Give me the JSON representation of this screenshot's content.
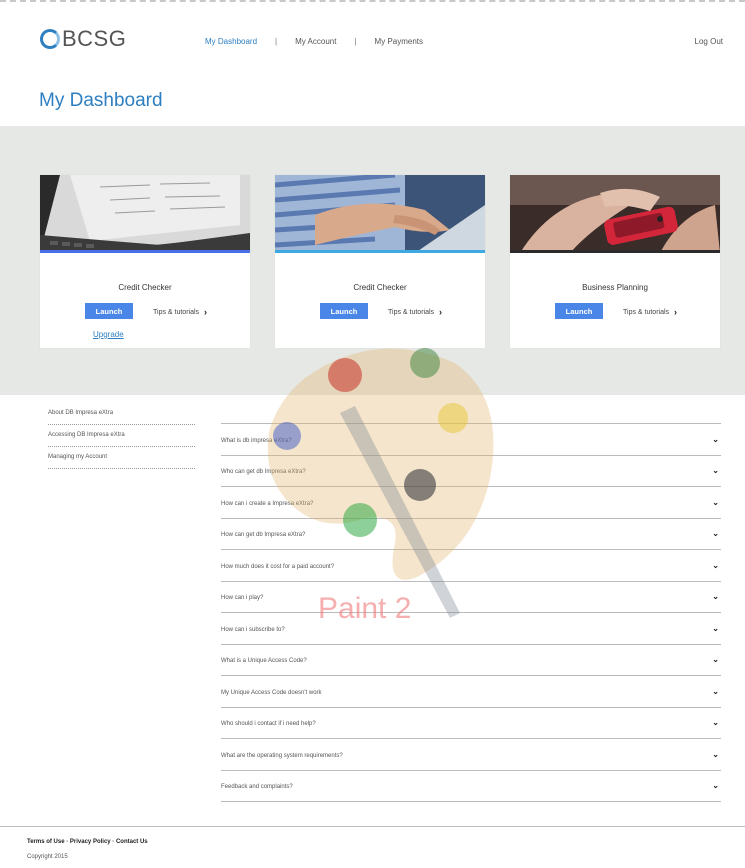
{
  "header": {
    "logo_text": "BCSG",
    "nav": [
      {
        "label": "My Dashboard",
        "active": true
      },
      {
        "label": "My Account",
        "active": false
      },
      {
        "label": "My Payments",
        "active": false
      }
    ],
    "nav_separator": "|",
    "logout_label": "Log Out"
  },
  "page_title": "My Dashboard",
  "cards": [
    {
      "title": "Credit Checker",
      "launch_label": "Launch",
      "tips_label": "Tips & tutorials",
      "upgrade_label": "Upgrade",
      "accent_color": "#4a6fe8"
    },
    {
      "title": "Credit Checker",
      "launch_label": "Launch",
      "tips_label": "Tips & tutorials",
      "accent_color": "#3da9e0"
    },
    {
      "title": "Business Planning",
      "launch_label": "Launch",
      "tips_label": "Tips & tutorials",
      "accent_color": "#2b2b2b"
    }
  ],
  "side_links": [
    "About DB Impresa eXtra",
    "Accessing DB Impresa eXtra",
    "Managing my Account"
  ],
  "faq": [
    "What is db impresa eXtra?",
    "Who can get db Impresa eXtra?",
    "How can i create a Impresa eXtra?",
    "How can get db Impresa eXtra?",
    "How much does it cost for a paid account?",
    "How can i play?",
    "How can i subscribe to?",
    "What is a Unique Access Code?",
    "My Unique Access Code doesn't work",
    "Who should i contact if i need help?",
    "What are the operating system requirements?",
    "Feedback and complaints?"
  ],
  "watermark_text": "Paint 2",
  "footer": {
    "links": [
      "Terms of Use",
      "Privacy Policy",
      "Contact Us"
    ],
    "copyright": "Copyright 2015"
  },
  "colors": {
    "brand": "#2e7fc1",
    "button": "#4a86e8",
    "band": "#e6e8e5"
  }
}
